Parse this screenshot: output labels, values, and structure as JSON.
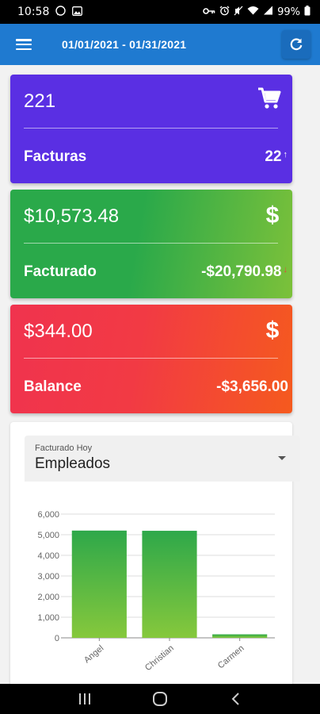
{
  "status_bar": {
    "time": "10:58",
    "battery_percent": "99%",
    "icons": [
      "whatsapp-icon",
      "gallery-icon",
      "key-icon",
      "alarm-icon",
      "mute-icon",
      "wifi-icon",
      "signal-icon",
      "battery-icon"
    ]
  },
  "app_bar": {
    "date_range": "01/01/2021 - 01/31/2021",
    "icons": [
      "menu-icon",
      "refresh-icon"
    ],
    "colors": {
      "background": "#1f7ad0"
    }
  },
  "cards": {
    "invoices": {
      "value": "221",
      "label": "Facturas",
      "compare": "22",
      "trend": "up",
      "icon": "cart-icon",
      "color": "#5a2fe3"
    },
    "billed": {
      "value": "$10,573.48",
      "label": "Facturado",
      "compare": "-$20,790.98",
      "trend": "down",
      "icon": "dollar-icon",
      "color": "#2aa94a"
    },
    "balance": {
      "value": "$344.00",
      "label": "Balance",
      "compare": "-$3,656.00",
      "icon": "dollar-icon",
      "color": "#f0334e"
    }
  },
  "chart_section": {
    "select_label": "Facturado Hoy",
    "select_value": "Empleados"
  },
  "chart_data": {
    "type": "bar",
    "categories": [
      "Angel",
      "Christian",
      "Carmen"
    ],
    "values": [
      5200,
      5190,
      170
    ],
    "yticks": [
      "6,000",
      "5,000",
      "4,000",
      "3,000",
      "2,000",
      "1,000",
      "0"
    ],
    "ylim": [
      0,
      6000
    ],
    "grid": true,
    "bar_color": "#3aaa4a"
  },
  "nav_bar": {
    "icons": [
      "recent-apps-icon",
      "home-icon",
      "back-icon"
    ]
  }
}
